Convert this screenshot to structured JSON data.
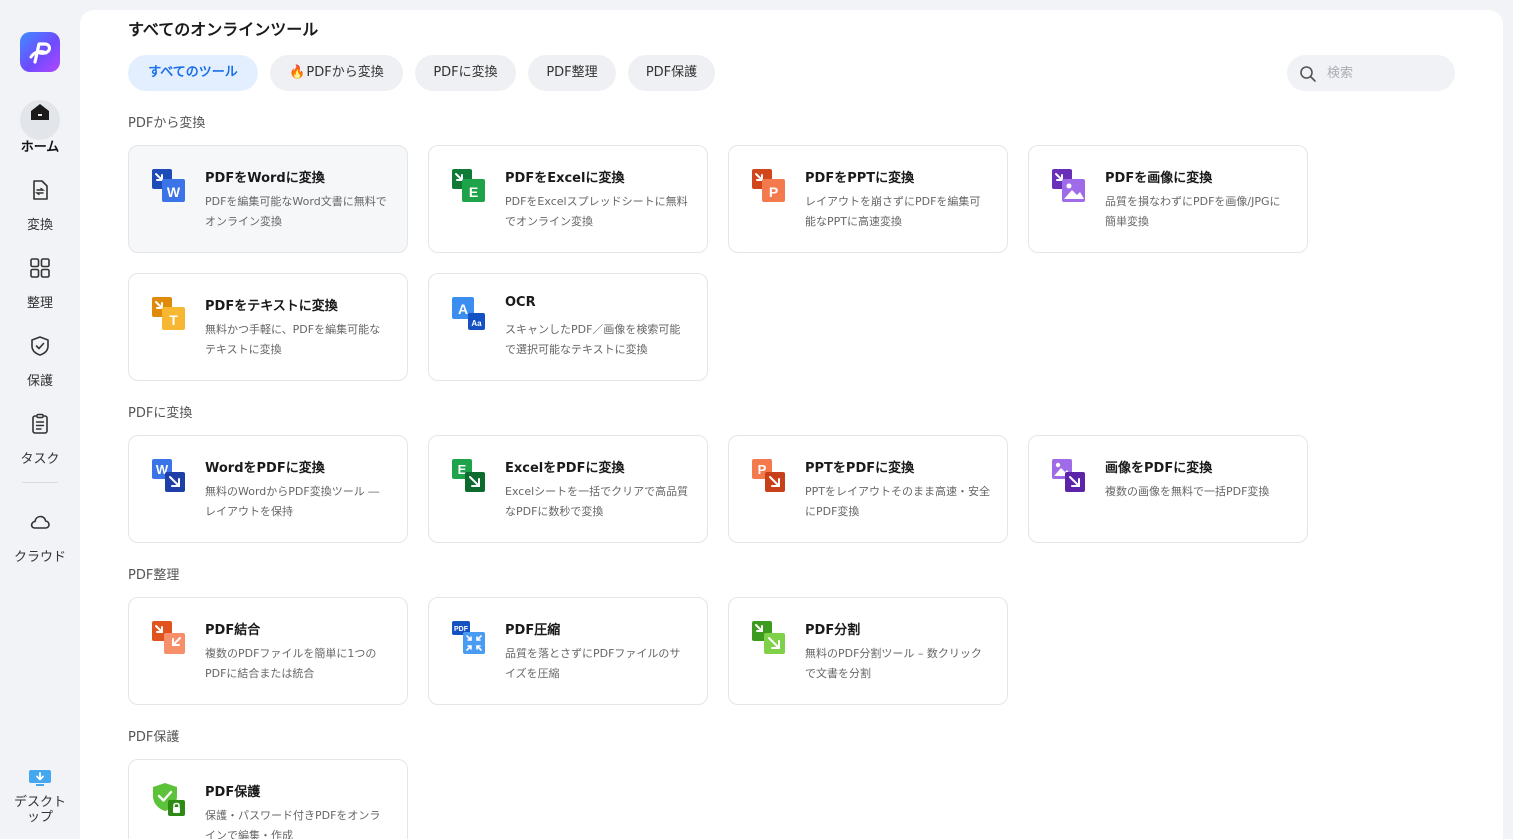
{
  "sidebar": {
    "items": [
      {
        "label": "ホーム",
        "icon": "home-icon"
      },
      {
        "label": "変換",
        "icon": "convert-icon"
      },
      {
        "label": "整理",
        "icon": "organize-icon"
      },
      {
        "label": "保護",
        "icon": "shield-icon"
      },
      {
        "label": "タスク",
        "icon": "task-icon"
      },
      {
        "label": "クラウド",
        "icon": "cloud-icon"
      }
    ],
    "desktop": {
      "label_line1": "デスクト",
      "label_line2": "ップ",
      "icon": "desktop-icon"
    }
  },
  "page_title": "すべてのオンラインツール",
  "tabs": [
    {
      "label": "すべてのツール"
    },
    {
      "label": "PDFから変換",
      "icon": "fire-icon"
    },
    {
      "label": "PDFに変換"
    },
    {
      "label": "PDF整理"
    },
    {
      "label": "PDF保護"
    }
  ],
  "search": {
    "placeholder": "検索"
  },
  "sections": [
    {
      "title": "PDFから変換",
      "cards": [
        {
          "title": "PDFをWordに変換",
          "desc": "PDFを編集可能なWord文書に無料でオンライン変換",
          "icon": "pdf-to-word-icon",
          "color": "#2b5cd6"
        },
        {
          "title": "PDFをExcelに変換",
          "desc": "PDFをExcelスプレッドシートに無料でオンライン変換",
          "icon": "pdf-to-excel-icon",
          "color": "#16a34a"
        },
        {
          "title": "PDFをPPTに変換",
          "desc": "レイアウトを崩さずにPDFを編集可能なPPTに高速変換",
          "icon": "pdf-to-ppt-icon",
          "color": "#f06a3c"
        },
        {
          "title": "PDFを画像に変換",
          "desc": "品質を損なわずにPDFを画像/JPGに簡単変換",
          "icon": "pdf-to-image-icon",
          "color": "#8b4fd8"
        },
        {
          "title": "PDFをテキストに変換",
          "desc": "無料かつ手軽に、PDFを編集可能なテキストに変換",
          "icon": "pdf-to-text-icon",
          "color": "#f5a623"
        },
        {
          "title": "OCR",
          "desc": "スキャンしたPDF／画像を検索可能で選択可能なテキストに変換",
          "icon": "ocr-icon",
          "color": "#2d7be5"
        }
      ]
    },
    {
      "title": "PDFに変換",
      "cards": [
        {
          "title": "WordをPDFに変換",
          "desc": "無料のWordからPDF変換ツール ― レイアウトを保持",
          "icon": "word-to-pdf-icon",
          "color": "#2b5cd6"
        },
        {
          "title": "ExcelをPDFに変換",
          "desc": "Excelシートを一括でクリアで高品質なPDFに数秒で変換",
          "icon": "excel-to-pdf-icon",
          "color": "#16a34a"
        },
        {
          "title": "PPTをPDFに変換",
          "desc": "PPTをレイアウトそのまま高速・安全にPDF変換",
          "icon": "ppt-to-pdf-icon",
          "color": "#f06a3c"
        },
        {
          "title": "画像をPDFに変換",
          "desc": "複数の画像を無料で一括PDF変換",
          "icon": "image-to-pdf-icon",
          "color": "#8b4fd8"
        }
      ]
    },
    {
      "title": "PDF整理",
      "cards": [
        {
          "title": "PDF結合",
          "desc": "複数のPDFファイルを簡単に1つのPDFに結合または統合",
          "icon": "merge-pdf-icon",
          "color": "#f06a3c"
        },
        {
          "title": "PDF圧縮",
          "desc": "品質を落とさずにPDFファイルのサイズを圧縮",
          "icon": "compress-pdf-icon",
          "color": "#2d7be5"
        },
        {
          "title": "PDF分割",
          "desc": "無料のPDF分割ツール – 数クリックで文書を分割",
          "icon": "split-pdf-icon",
          "color": "#4caf2f"
        }
      ]
    },
    {
      "title": "PDF保護",
      "cards": [
        {
          "title": "PDF保護",
          "desc": "保護・パスワード付きPDFをオンラインで編集・作成",
          "icon": "protect-pdf-icon",
          "color": "#4caf2f"
        }
      ]
    }
  ]
}
